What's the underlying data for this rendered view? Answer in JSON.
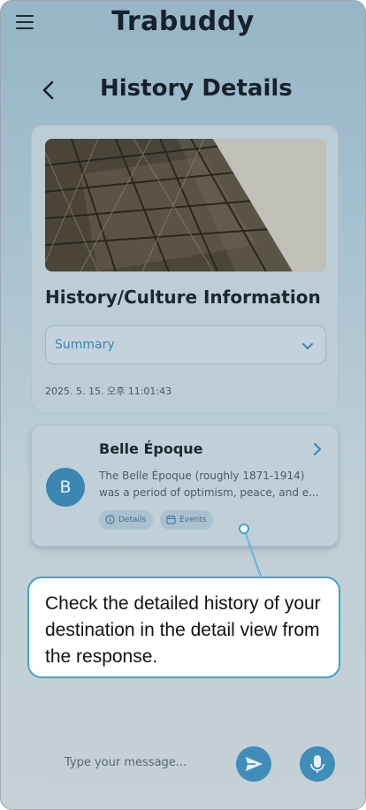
{
  "app": {
    "title": "Trabuddy"
  },
  "header": {
    "page_title": "History Details"
  },
  "main_card": {
    "section_title": "History/Culture Information",
    "dropdown_selected": "Summary",
    "timestamp": "2025. 5. 15. 오후 11:01:43"
  },
  "history_item": {
    "avatar_letter": "B",
    "title": "Belle Époque",
    "description_lines": [
      "The Belle Époque (roughly 1871-1914)",
      "was a period of optimism, peace, and e..."
    ],
    "chips": [
      {
        "label": "Details",
        "icon": "info-icon"
      },
      {
        "label": "Events",
        "icon": "calendar-icon"
      }
    ]
  },
  "tooltip": {
    "text": "Check the detailed history of your destination in the detail view from the response."
  },
  "composer": {
    "placeholder": "Type your message..."
  },
  "colors": {
    "accent": "#3f8db9",
    "tooltip_border": "#3da3d6"
  }
}
